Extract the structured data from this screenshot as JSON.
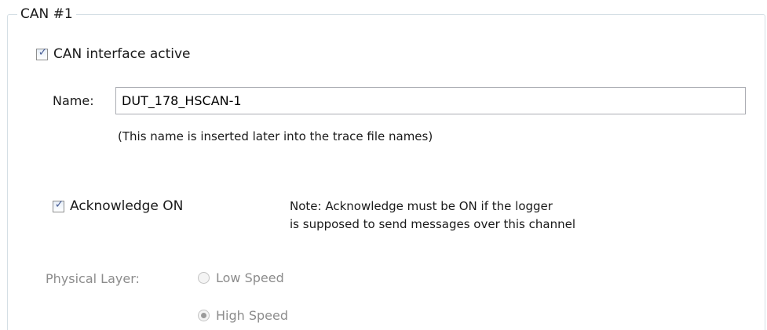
{
  "group": {
    "title": "CAN #1"
  },
  "interface_active": {
    "label": "CAN interface active",
    "checked": true
  },
  "name": {
    "label": "Name:",
    "value": "DUT_178_HSCAN-1",
    "hint": "(This name is inserted later into the trace file names)"
  },
  "acknowledge": {
    "label": "Acknowledge ON",
    "checked": true,
    "note_line1": "Note: Acknowledge must be ON if the logger",
    "note_line2": "is supposed to send messages over this channel"
  },
  "physical_layer": {
    "label": "Physical Layer:",
    "options": [
      {
        "label": "Low Speed",
        "selected": false
      },
      {
        "label": "High Speed",
        "selected": true
      }
    ],
    "disabled": true
  },
  "icons": {
    "check": "check-mark-icon"
  },
  "colors": {
    "check": "#4a5f97",
    "disabled_text": "#8c8c8c",
    "group_border": "#d5dfe5"
  }
}
